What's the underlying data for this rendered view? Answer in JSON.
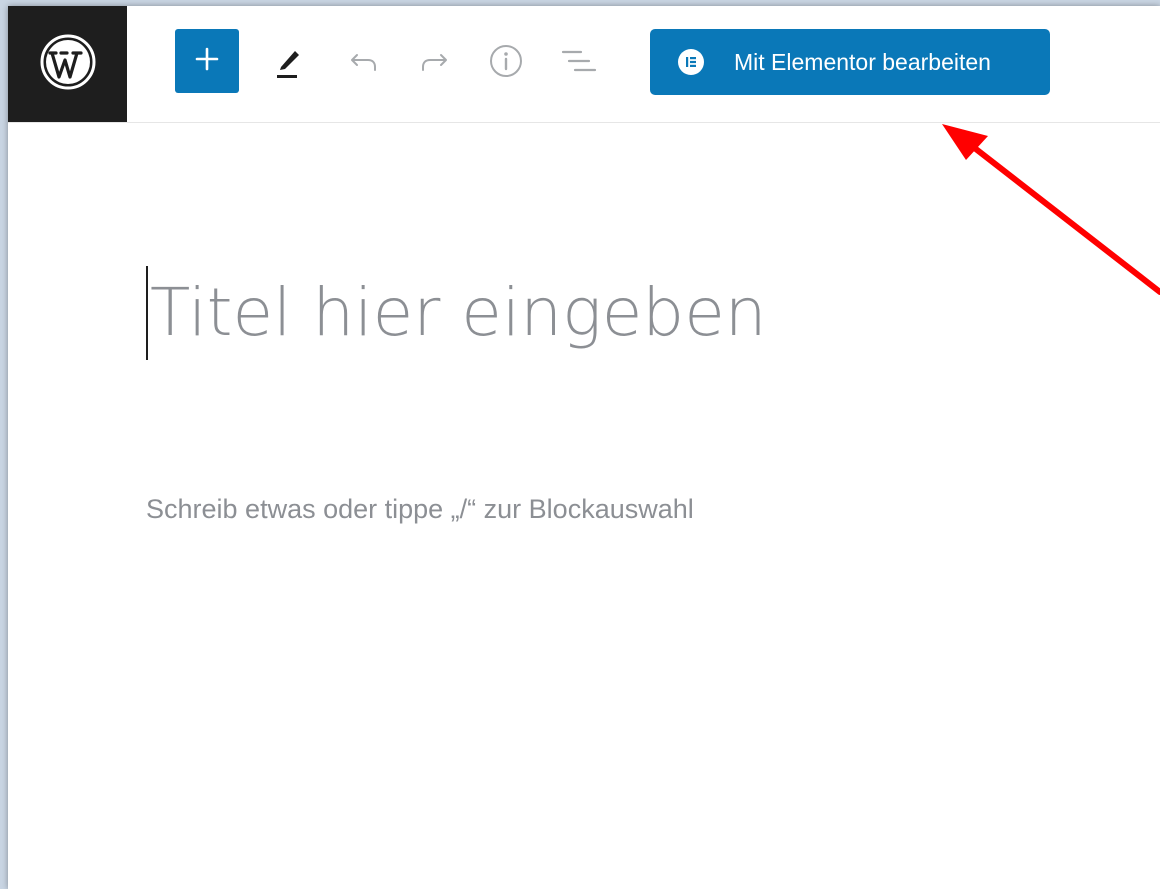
{
  "toolbar": {
    "logo_icon": "wordpress-logo-icon",
    "add_block_icon": "plus-icon",
    "tools_icon": "pencil-icon",
    "undo_icon": "undo-icon",
    "redo_icon": "redo-icon",
    "details_icon": "info-icon",
    "outline_icon": "list-view-icon",
    "elementor_button": {
      "icon": "elementor-icon",
      "label": "Mit Elementor bearbeiten",
      "color": "#0a78b8"
    }
  },
  "editor": {
    "title_placeholder": "Titel hier eingeben",
    "block_placeholder": "Schreib etwas oder tippe „/“ zur Blockauswahl"
  },
  "annotation": {
    "arrow_icon": "red-arrow-icon",
    "color": "#ff0000"
  }
}
